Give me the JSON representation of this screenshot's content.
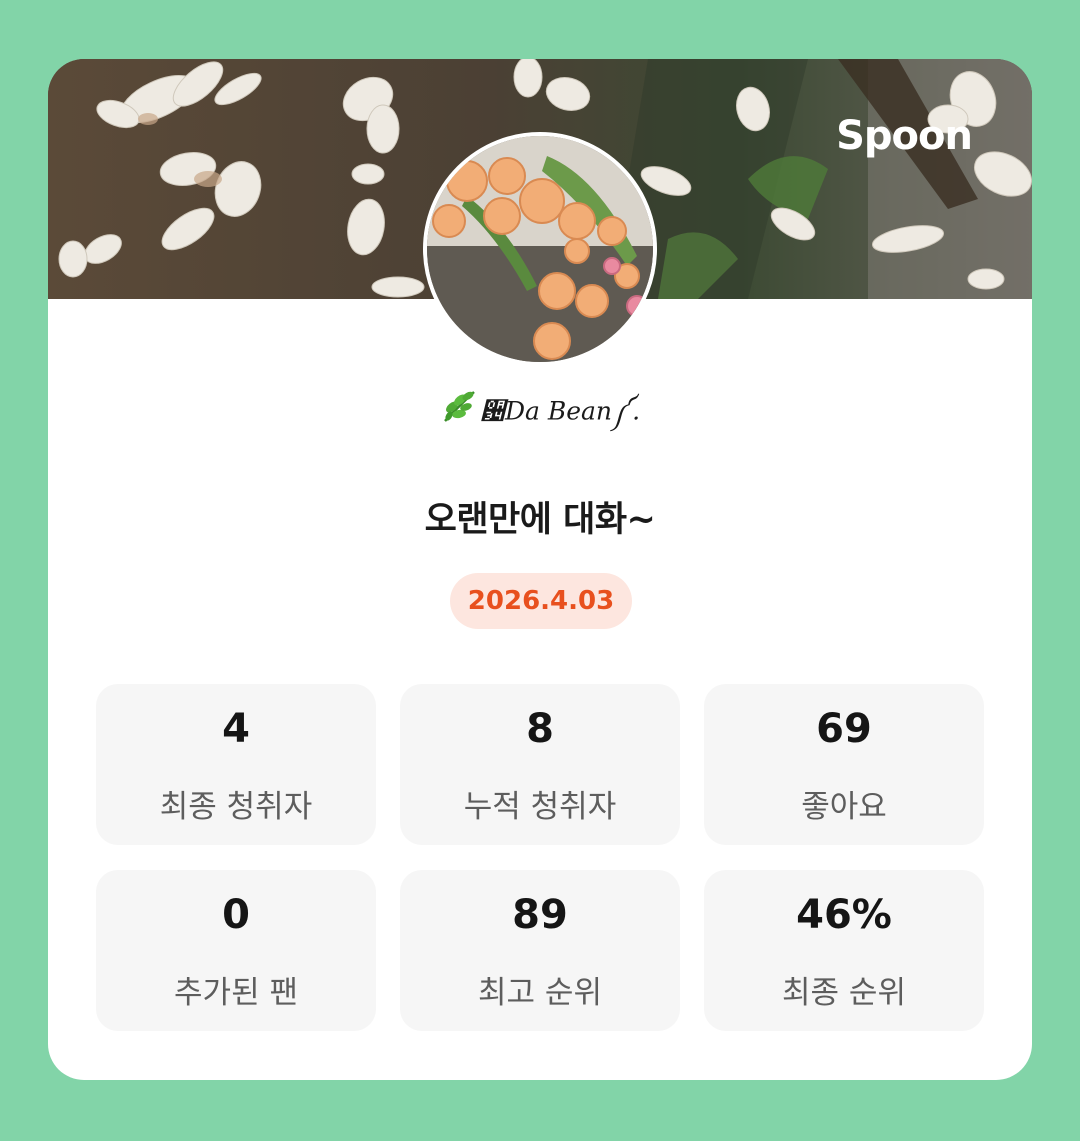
{
  "card": {
    "brand": "Spoon",
    "nickname": "਴Da Bean༼.",
    "nickname_emoji": "herb-icon",
    "title": "오랜만에 대화~",
    "date": "2026.4.03"
  },
  "stats": [
    {
      "value": "4",
      "label": "최종 청취자"
    },
    {
      "value": "8",
      "label": "누적 청취자"
    },
    {
      "value": "69",
      "label": "좋아요"
    },
    {
      "value": "0",
      "label": "추가된 팬"
    },
    {
      "value": "89",
      "label": "최고 순위"
    },
    {
      "value": "46%",
      "label": "최종 순위"
    }
  ],
  "colors": {
    "background": "#82d4a8",
    "date_text": "#e8501e",
    "date_badge": "#fde6df",
    "stat_box": "#f6f6f6"
  }
}
